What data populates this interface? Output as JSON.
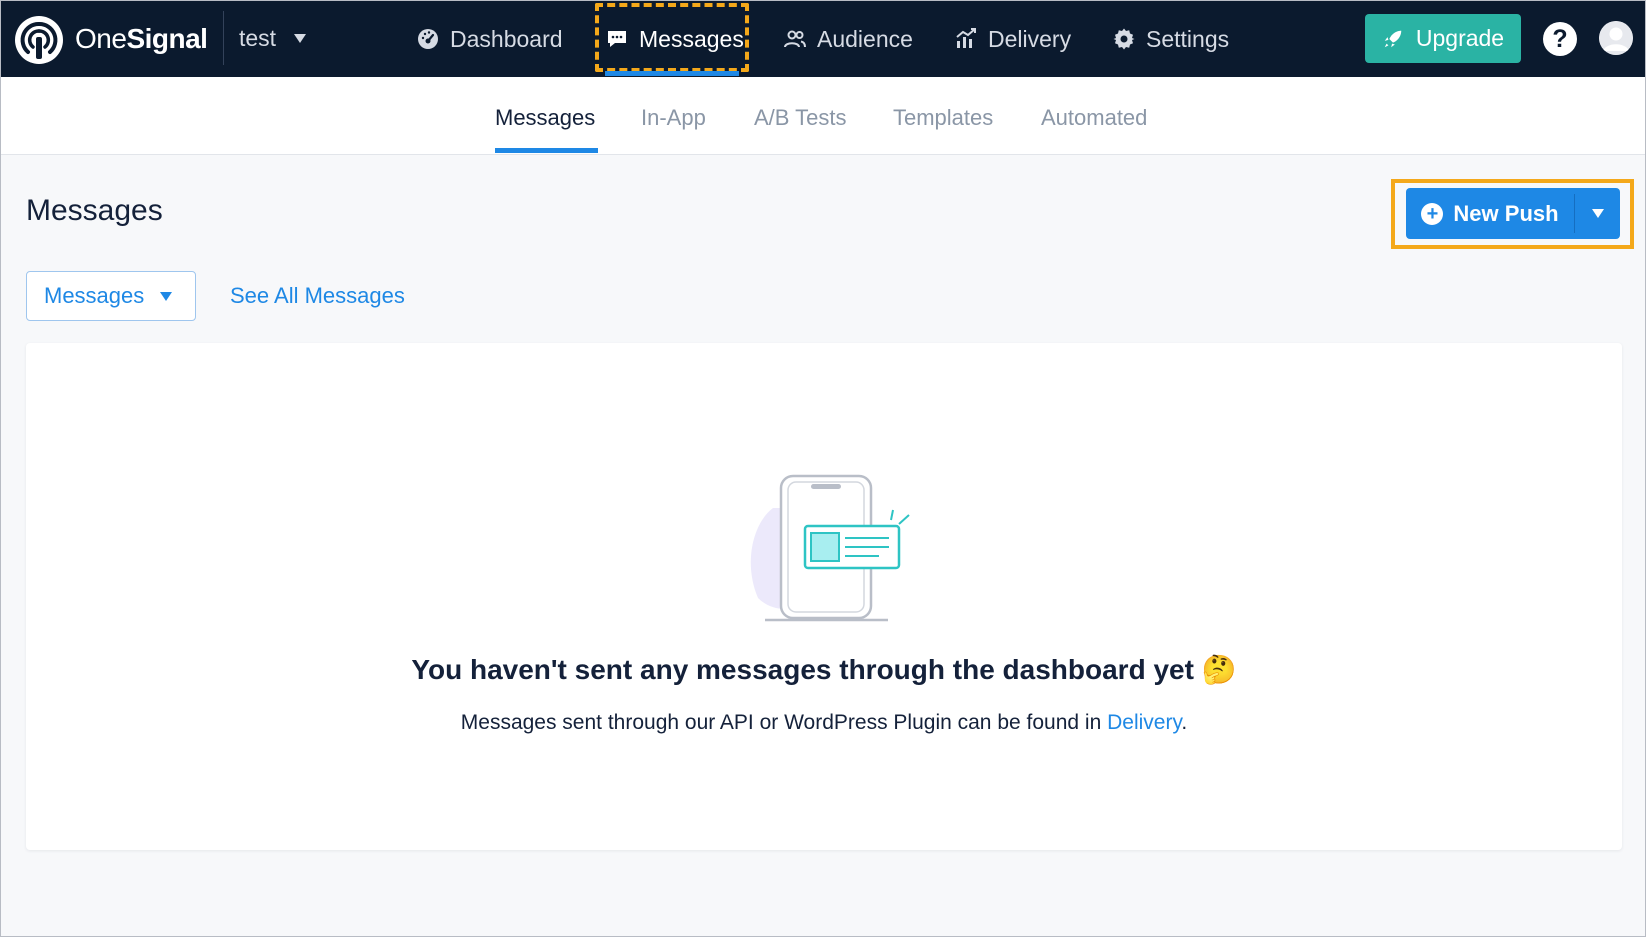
{
  "brand": {
    "name_light": "One",
    "name_bold": "Signal",
    "icon": "onesignal-logo-icon"
  },
  "app_selector": {
    "value": "test"
  },
  "nav": {
    "items": [
      {
        "label": "Dashboard",
        "icon": "gauge-icon"
      },
      {
        "label": "Messages",
        "icon": "chat-icon",
        "active": true
      },
      {
        "label": "Audience",
        "icon": "users-icon"
      },
      {
        "label": "Delivery",
        "icon": "chart-icon"
      },
      {
        "label": "Settings",
        "icon": "gear-icon"
      }
    ],
    "upgrade_label": "Upgrade",
    "help_label": "?"
  },
  "subtabs": [
    {
      "label": "Messages",
      "active": true
    },
    {
      "label": "In-App"
    },
    {
      "label": "A/B Tests"
    },
    {
      "label": "Templates"
    },
    {
      "label": "Automated"
    }
  ],
  "page": {
    "title": "Messages",
    "new_push_label": "New Push",
    "filter_value": "Messages",
    "see_all_label": "See All Messages"
  },
  "empty_state": {
    "title": "You haven't sent any messages through the dashboard yet",
    "emoji": "🤔",
    "subtitle_prefix": "Messages sent through our API or WordPress Plugin can be found in ",
    "subtitle_link": "Delivery",
    "subtitle_suffix": "."
  },
  "colors": {
    "navbar": "#0b1a2e",
    "accent_blue": "#1e88e5",
    "upgrade_teal": "#2ab3a4",
    "highlight_orange": "#f4a81a"
  }
}
